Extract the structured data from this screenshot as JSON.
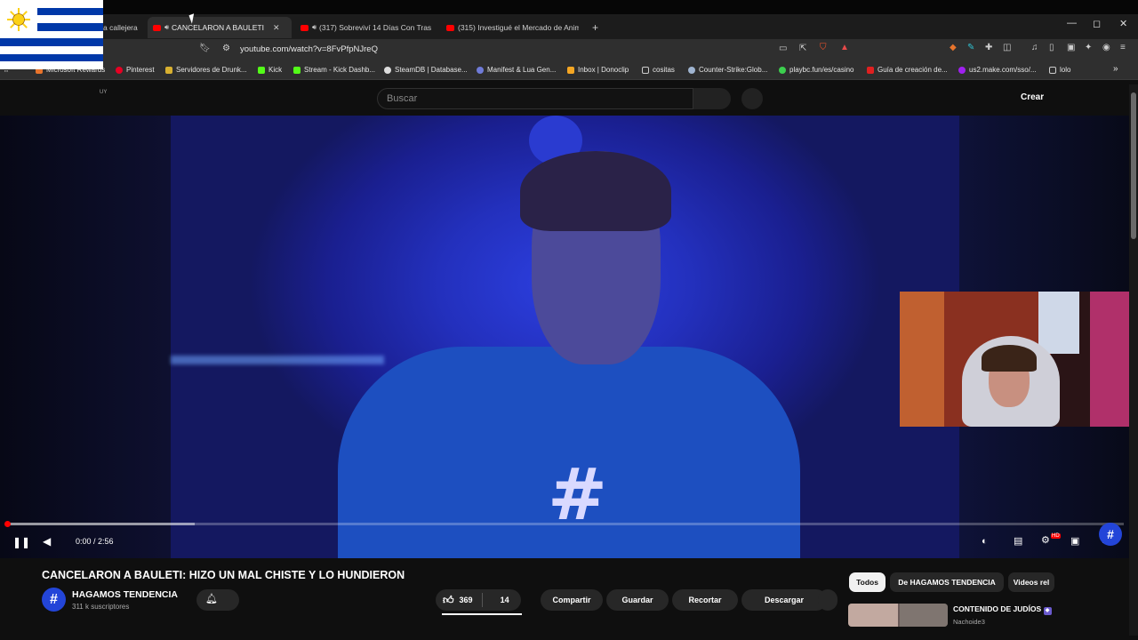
{
  "browser": {
    "tabs": [
      {
        "label": "a callejera",
        "active": false
      },
      {
        "label": "CANCELARON A BAULETI: HI",
        "active": true
      },
      {
        "label": "(317) Sobreviví 14 Días Con Tras",
        "active": false
      },
      {
        "label": "(315) Investigué el Mercado de Anim",
        "active": false
      }
    ],
    "new_tab": "+",
    "close_glyph": "✕",
    "window_controls": [
      "—",
      "◻",
      "✕"
    ],
    "url": "youtube.com/watch?v=8FvPfpNJreQ",
    "bookmarks": [
      {
        "label": "Microsoft Rewards",
        "color": "#e8742c"
      },
      {
        "label": "Pinterest",
        "color": "#e60023"
      },
      {
        "label": "Servidores de Drunk...",
        "color": "#d8b030"
      },
      {
        "label": "Kick",
        "color": "#53fc18"
      },
      {
        "label": "Stream - Kick Dashb...",
        "color": "#53fc18"
      },
      {
        "label": "SteamDB | Database...",
        "color": "#dddddd"
      },
      {
        "label": "Manifest & Lua Gen...",
        "color": "#6f7bd8"
      },
      {
        "label": "Inbox | Donoclip",
        "color": "#f5a623"
      },
      {
        "label": "cositas",
        "color": "#cccccc"
      },
      {
        "label": "Counter-Strike:Glob...",
        "color": "#9fb4d0"
      },
      {
        "label": "playbc.fun/es/casino",
        "color": "#3ccf4e"
      },
      {
        "label": "Guía de creación de...",
        "color": "#e02020"
      },
      {
        "label": "us2.make.com/sso/...",
        "color": "#a020f0"
      },
      {
        "label": "lolo",
        "color": "#cccccc"
      }
    ],
    "more_bookmarks": "»"
  },
  "youtube": {
    "country_code": "UY",
    "search_placeholder": "Buscar",
    "create_label": "Crear",
    "player": {
      "time": "0:00 / 2:56",
      "progress_fraction": 0.0,
      "buffered_fraction": 0.168,
      "settings_badge": "HD"
    },
    "video_title": "CANCELARON A BAULETI: HIZO UN MAL CHISTE Y LO HUNDIERON",
    "channel": {
      "name": "HAGAMOS TENDENCIA",
      "subscribers": "311 k suscriptores",
      "avatar_text": "#"
    },
    "actions": {
      "likes": "369",
      "dislike_count": "14",
      "share": "Compartir",
      "save": "Guardar",
      "clip": "Recortar",
      "download": "Descargar"
    },
    "chips": [
      {
        "label": "Todos",
        "selected": true
      },
      {
        "label": "De HAGAMOS TENDENCIA",
        "selected": false
      },
      {
        "label": "Videos rel",
        "selected": false
      }
    ],
    "recommendation": {
      "title": "CONTENIDO DE JUDÍOS",
      "channel": "Nachoide3"
    }
  },
  "colors": {
    "accent_red": "#ff0000",
    "flag_blue": "#0038a8",
    "flag_sun": "#fcd116"
  }
}
